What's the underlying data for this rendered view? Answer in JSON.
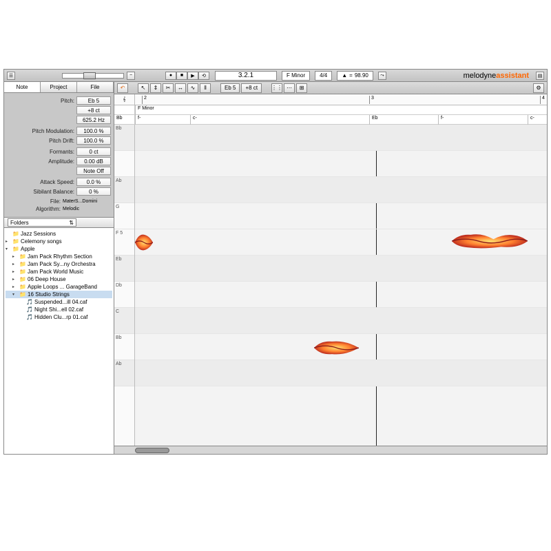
{
  "topbar": {
    "position": "3.2.1",
    "key": "F Minor",
    "time_sig": "4/4",
    "tempo": "98.90"
  },
  "brand": {
    "name": "melodyne",
    "edition": "assistant"
  },
  "tabs": {
    "note": "Note",
    "project": "Project",
    "file": "File"
  },
  "inspector": {
    "pitch_label": "Pitch:",
    "pitch": "Eb 5",
    "cents": "+8 ct",
    "hz": "625.2 Hz",
    "pm_label": "Pitch Modulation:",
    "pm": "100.0 %",
    "pd_label": "Pitch Drift:",
    "pd": "100.0 %",
    "fm_label": "Formants:",
    "fm": "0 ct",
    "amp_label": "Amplitude:",
    "amp": "0.00 dB",
    "noteoff": "Note Off",
    "atk_label": "Attack Speed:",
    "atk": "0.0 %",
    "sib_label": "Sibilant Balance:",
    "sib": "0 %",
    "file_label": "File:",
    "file": "MaterS...Domini",
    "algo_label": "Algorithm:",
    "algo": "Melodic"
  },
  "folders": {
    "label": "Folders",
    "items": [
      {
        "ind": 0,
        "arrow": "",
        "icon": "📁",
        "name": "Jazz Sessions"
      },
      {
        "ind": 0,
        "arrow": "▸",
        "icon": "📁",
        "name": "Celemony songs"
      },
      {
        "ind": 0,
        "arrow": "▾",
        "icon": "📁",
        "name": "Apple"
      },
      {
        "ind": 1,
        "arrow": "▸",
        "icon": "📁",
        "name": "Jam Pack Rhythm Section"
      },
      {
        "ind": 1,
        "arrow": "▸",
        "icon": "📁",
        "name": "Jam Pack Sy...ny Orchestra"
      },
      {
        "ind": 1,
        "arrow": "▸",
        "icon": "📁",
        "name": "Jam Pack World Music"
      },
      {
        "ind": 1,
        "arrow": "▸",
        "icon": "📁",
        "name": "06 Deep House"
      },
      {
        "ind": 1,
        "arrow": "▸",
        "icon": "📁",
        "name": "Apple Loops ... GarageBand"
      },
      {
        "ind": 1,
        "arrow": "▾",
        "icon": "📁",
        "name": "16 Studio Strings",
        "sel": true
      },
      {
        "ind": 2,
        "arrow": "",
        "icon": "🎵",
        "name": "Suspended...ill 04.caf"
      },
      {
        "ind": 2,
        "arrow": "",
        "icon": "🎵",
        "name": "Night Shi...ell 02.caf"
      },
      {
        "ind": 2,
        "arrow": "",
        "icon": "🎵",
        "name": "Hidden Clu...rp 01.caf"
      }
    ]
  },
  "tools": {
    "pitch": "Eb 5",
    "cents": "+8 ct"
  },
  "ruler": {
    "scale": "F Minor",
    "m2": "2",
    "m3": "3",
    "m4": "4"
  },
  "keyrow": {
    "fminus": "f-",
    "cminus": "c-",
    "eb": "Eb"
  },
  "lanes": [
    "Bb",
    "",
    "Ab",
    "G",
    "F 5",
    "Eb",
    "Db",
    "C",
    "Bb",
    "Ab"
  ]
}
